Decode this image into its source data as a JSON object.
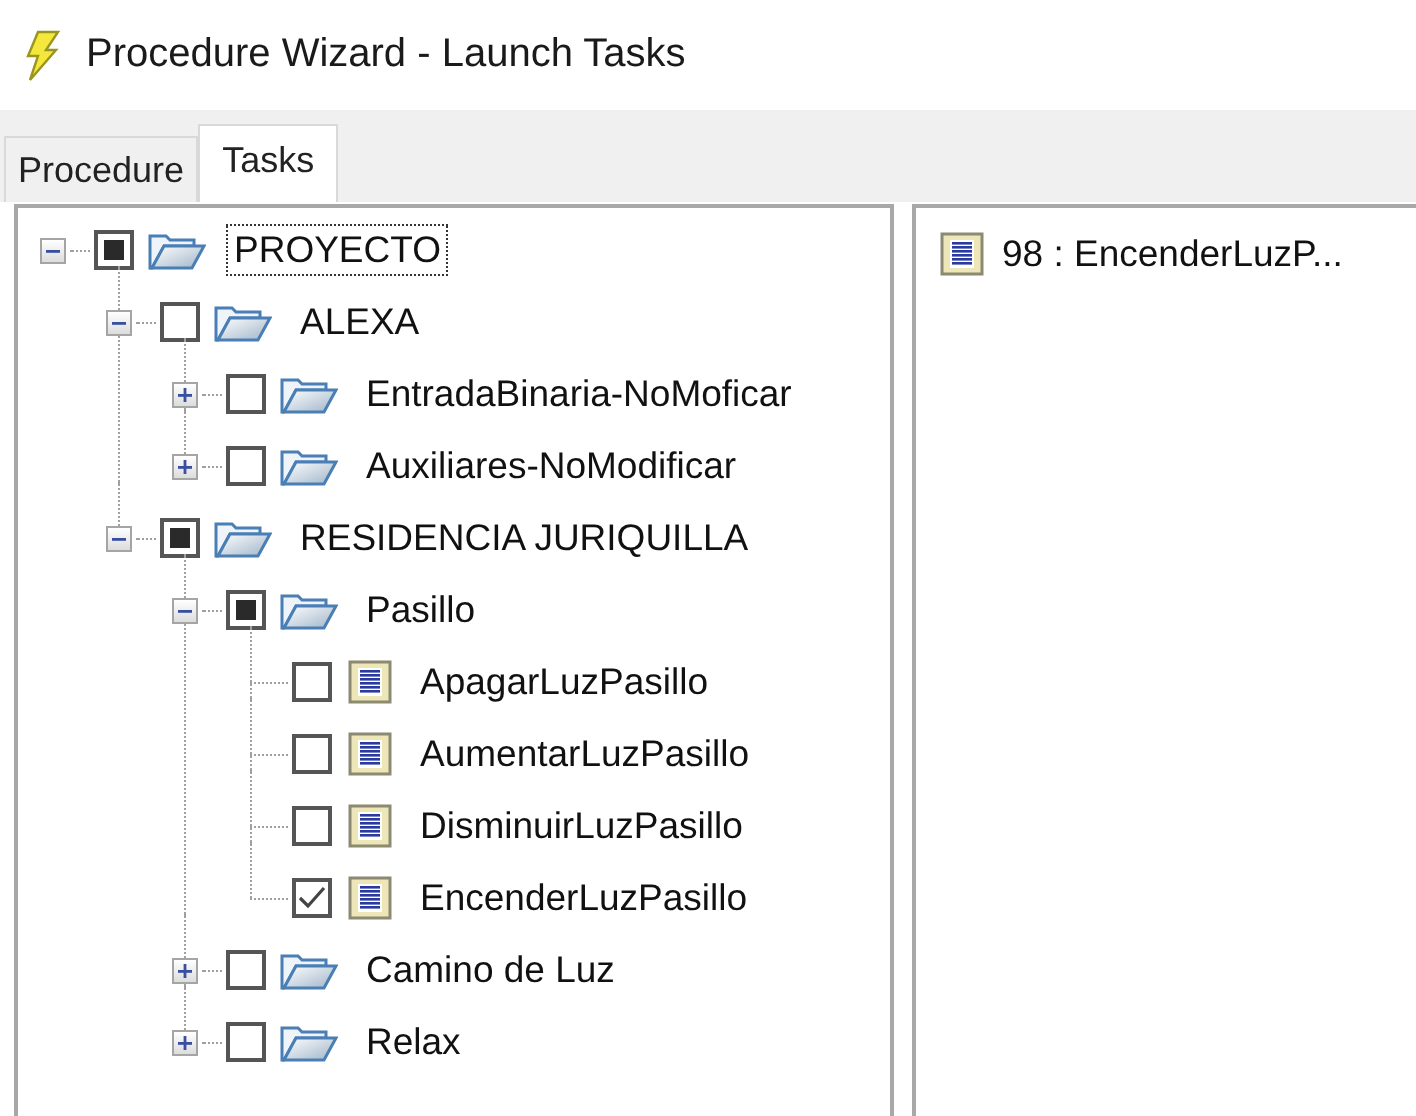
{
  "window": {
    "title": "Procedure Wizard - Launch Tasks"
  },
  "tabs": [
    {
      "label": "Procedure",
      "selected": false
    },
    {
      "label": "Tasks",
      "selected": true
    }
  ],
  "tree": [
    {
      "kind": "folder",
      "label": "PROYECTO",
      "checked": false,
      "partial": true,
      "expanded": true,
      "focused": true,
      "children": [
        {
          "kind": "folder",
          "label": "ALEXA",
          "checked": false,
          "partial": false,
          "expanded": true,
          "focused": false,
          "children": [
            {
              "kind": "folder",
              "label": "EntradaBinaria-NoMoficar",
              "checked": false,
              "partial": false,
              "expanded": false,
              "focused": false
            },
            {
              "kind": "folder",
              "label": "Auxiliares-NoModificar",
              "checked": false,
              "partial": false,
              "expanded": false,
              "focused": false
            }
          ]
        },
        {
          "kind": "folder",
          "label": "RESIDENCIA JURIQUILLA",
          "checked": false,
          "partial": true,
          "expanded": true,
          "focused": false,
          "children": [
            {
              "kind": "folder",
              "label": "Pasillo",
              "checked": false,
              "partial": true,
              "expanded": true,
              "focused": false,
              "children": [
                {
                  "kind": "task",
                  "label": "ApagarLuzPasillo",
                  "checked": false,
                  "partial": false,
                  "focused": false
                },
                {
                  "kind": "task",
                  "label": "AumentarLuzPasillo",
                  "checked": false,
                  "partial": false,
                  "focused": false
                },
                {
                  "kind": "task",
                  "label": "DisminuirLuzPasillo",
                  "checked": false,
                  "partial": false,
                  "focused": false
                },
                {
                  "kind": "task",
                  "label": "EncenderLuzPasillo",
                  "checked": true,
                  "partial": false,
                  "focused": false
                }
              ]
            },
            {
              "kind": "folder",
              "label": "Camino de Luz",
              "checked": false,
              "partial": false,
              "expanded": false,
              "focused": false
            },
            {
              "kind": "folder",
              "label": "Relax",
              "checked": false,
              "partial": false,
              "expanded": false,
              "focused": false
            }
          ]
        }
      ]
    }
  ],
  "launch_list": [
    {
      "kind": "task",
      "label": "98 : EncenderLuzP..."
    }
  ]
}
